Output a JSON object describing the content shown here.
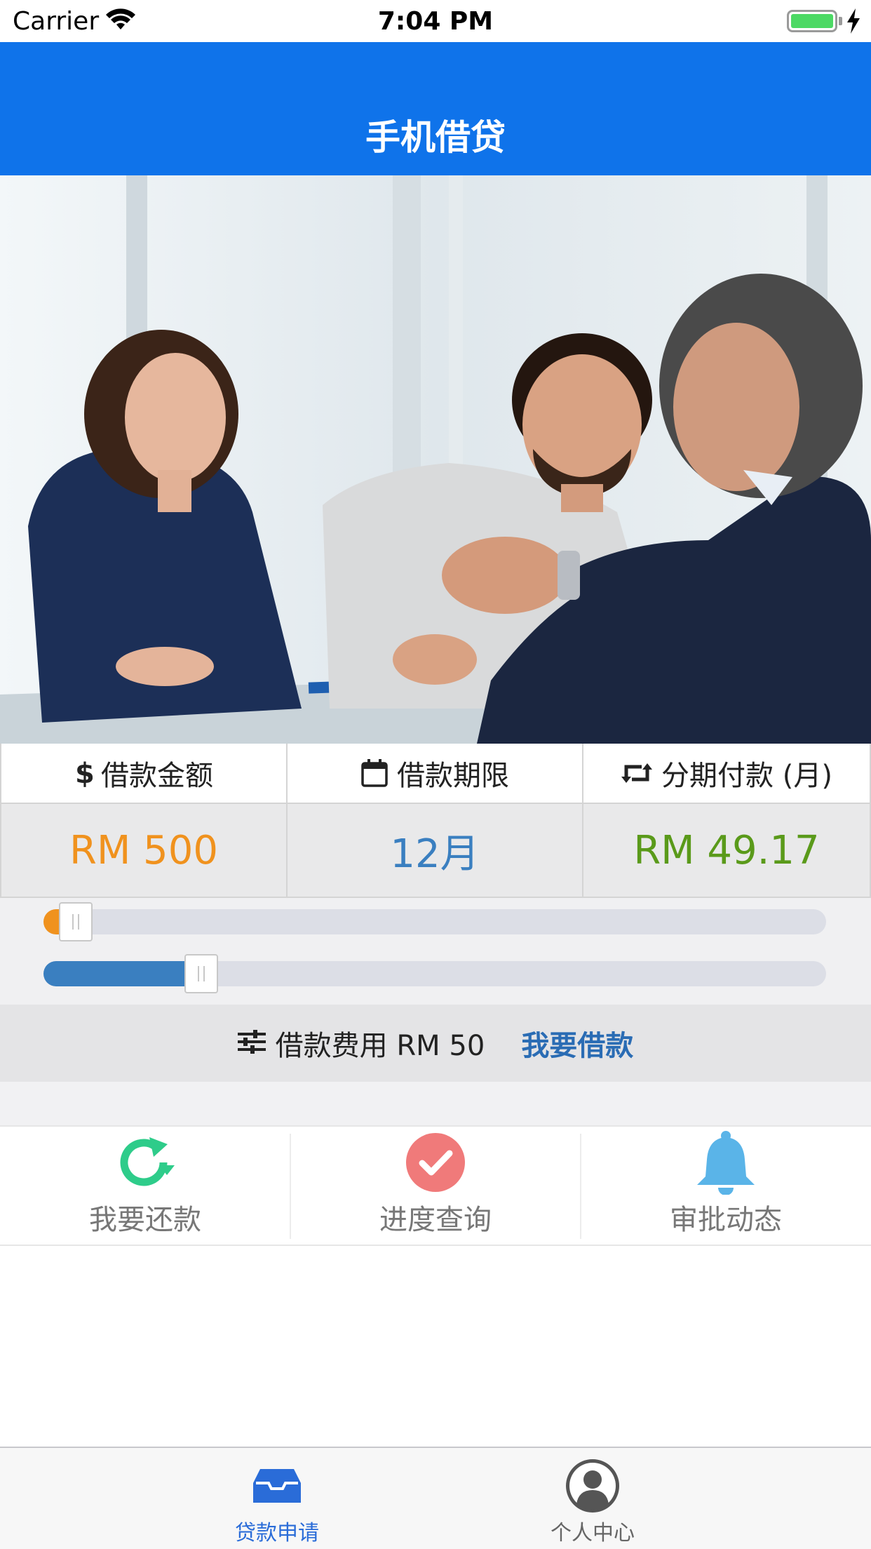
{
  "status_bar": {
    "carrier": "Carrier",
    "time": "7:04 PM"
  },
  "header": {
    "title": "手机借贷"
  },
  "hero": {
    "image": "business-handshake-photo"
  },
  "loan_info": {
    "amount": {
      "label": "借款金额",
      "value": "RM 500",
      "icon": "dollar-icon"
    },
    "term": {
      "label": "借款期限",
      "value": "12月",
      "icon": "calendar-icon"
    },
    "installment": {
      "label": "分期付款 (月)",
      "value": "RM 49.17",
      "icon": "retweet-icon"
    }
  },
  "sliders": {
    "amount_level": 0.02,
    "term_level": 0.18
  },
  "fee_bar": {
    "fee_text": "借款费用 RM 50",
    "apply_label": "我要借款",
    "icon": "sliders-icon"
  },
  "actions": [
    {
      "label": "我要还款",
      "icon": "refresh-icon"
    },
    {
      "label": "进度查询",
      "icon": "check-circle-icon"
    },
    {
      "label": "审批动态",
      "icon": "bell-icon"
    }
  ],
  "tabs": [
    {
      "label": "贷款申请",
      "icon": "inbox-icon",
      "active": true
    },
    {
      "label": "个人中心",
      "icon": "user-avatar-icon",
      "active": false
    }
  ],
  "colors": {
    "header_bg": "#0f73ea",
    "amount": "#f0921e",
    "term": "#3a7fc0",
    "installment": "#5a9a1a",
    "apply_link": "#2a6cb4",
    "refresh_icon": "#2ecc8a",
    "check_icon": "#f07a7a",
    "bell_icon": "#5ab4e8",
    "tab_active": "#2a6cd8"
  }
}
